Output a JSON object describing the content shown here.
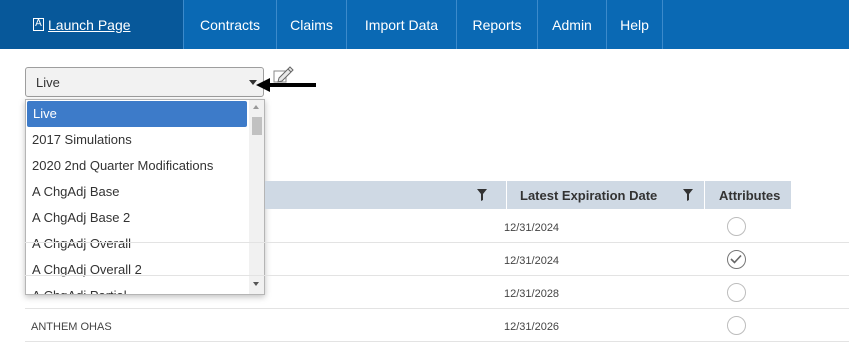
{
  "nav": {
    "items": [
      {
        "label": "Launch Page",
        "icon": "A"
      },
      {
        "label": "Contracts"
      },
      {
        "label": "Claims"
      },
      {
        "label": "Import Data"
      },
      {
        "label": "Reports"
      },
      {
        "label": "Admin"
      },
      {
        "label": "Help"
      }
    ]
  },
  "select": {
    "value": "Live",
    "options": [
      "Live",
      "2017 Simulations",
      "2020 2nd Quarter Modifications",
      "A ChgAdj Base",
      "A ChgAdj Base 2",
      "A ChgAdj Overall",
      "A ChgAdj Overall 2",
      "A ChgAdj Partial"
    ]
  },
  "grid": {
    "columns": [
      "Latest Expiration Date",
      "Attributes"
    ],
    "rows": [
      {
        "name": "",
        "date": "12/31/2024",
        "attribute_checked": false
      },
      {
        "name": "",
        "date": "12/31/2024",
        "attribute_checked": true
      },
      {
        "name": "",
        "date": "12/31/2028",
        "attribute_checked": false
      },
      {
        "name": "ANTHEM OHAS",
        "date": "12/31/2026",
        "attribute_checked": false
      }
    ]
  },
  "colors": {
    "nav_bg": "#0a69b4",
    "selected_option": "#3d7bc9",
    "grid_header": "#cfd9e4"
  }
}
